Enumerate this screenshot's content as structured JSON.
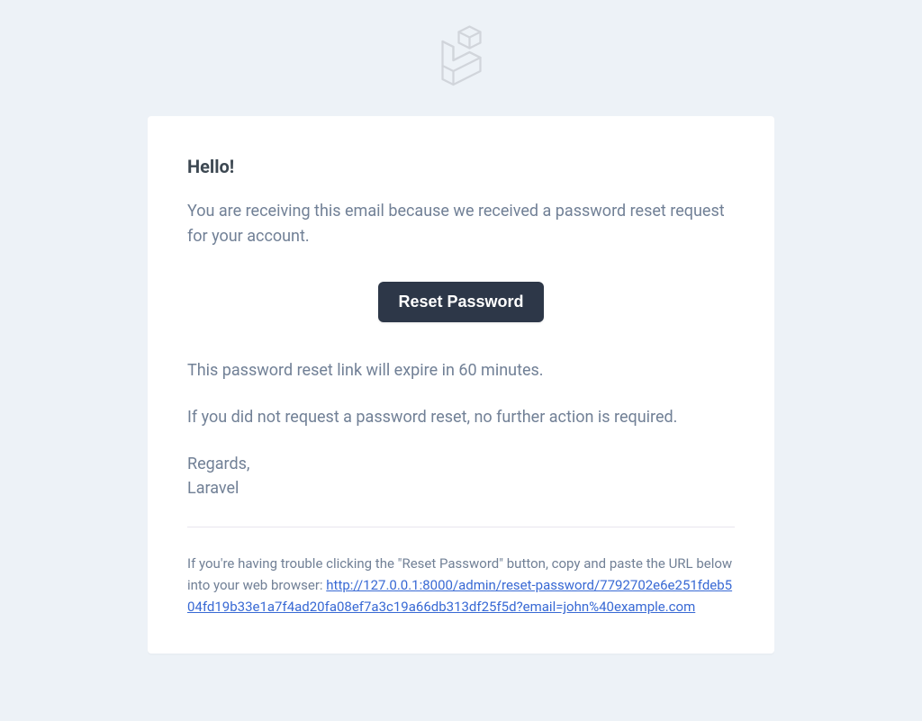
{
  "greeting": "Hello!",
  "intro": "You are receiving this email because we received a password reset request for your account.",
  "button_label": "Reset Password",
  "expire_notice": "This password reset link will expire in 60 minutes.",
  "no_action_notice": "If you did not request a password reset, no further action is required.",
  "closing_salutation": "Regards,",
  "closing_name": "Laravel",
  "subcopy_lead": "If you're having trouble clicking the \"Reset Password\" button, copy and paste the URL below into your web browser: ",
  "reset_url": "http://127.0.0.1:8000/admin/reset-password/7792702e6e251fdeb504fd19b33e1a7f4ad20fa08ef7a3c19a66db313df25f5d?email=john%40example.com"
}
